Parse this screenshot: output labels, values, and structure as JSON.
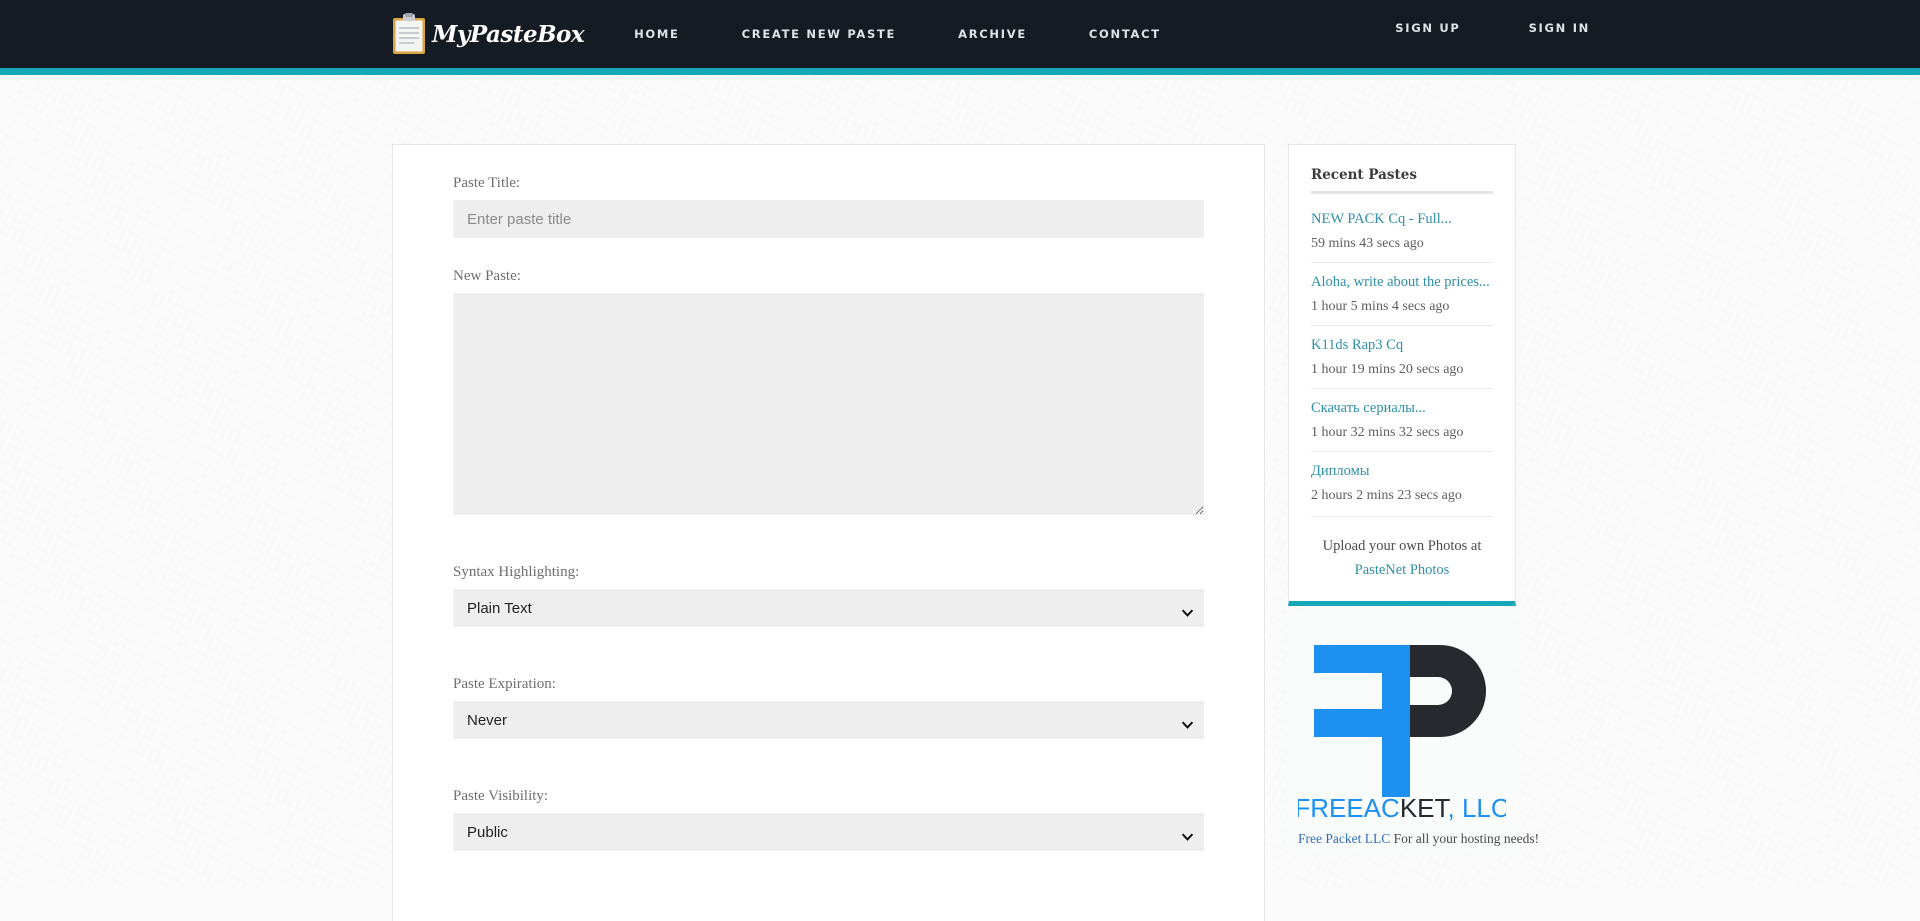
{
  "site": {
    "brand_name": "MyPasteBox",
    "logo_icon": "clipboard-icon",
    "accent_color": "#17a8b8",
    "header_bg": "#141b22"
  },
  "nav": {
    "items": [
      {
        "label": "HOME",
        "name": "nav-home"
      },
      {
        "label": "CREATE NEW PASTE",
        "name": "nav-create-new-paste"
      },
      {
        "label": "ARCHIVE",
        "name": "nav-archive"
      },
      {
        "label": "CONTACT",
        "name": "nav-contact"
      }
    ],
    "auth": [
      {
        "label": "SIGN UP",
        "name": "sign-up-link"
      },
      {
        "label": "SIGN IN",
        "name": "sign-in-link"
      }
    ]
  },
  "form": {
    "title_label": "Paste Title:",
    "title_value": "",
    "title_placeholder": "Enter paste title",
    "paste_label": "New Paste:",
    "paste_value": "",
    "paste_placeholder": "",
    "syntax_label": "Syntax Highlighting:",
    "syntax_value": "Plain Text",
    "syntax_options": [
      "Plain Text"
    ],
    "expiration_label": "Paste Expiration:",
    "expiration_value": "Never",
    "expiration_options": [
      "Never"
    ],
    "visibility_label": "Paste Visibility:",
    "visibility_value": "Public",
    "visibility_options": [
      "Public"
    ],
    "dropdown_icon": "chevron-down-icon"
  },
  "sidebar": {
    "title": "Recent Pastes",
    "pastes": [
      {
        "title": "NEW PACK Cq - Full...",
        "time": "59 mins 43 secs ago"
      },
      {
        "title": "Aloha, write about the prices...",
        "time": "1 hour 5 mins 4 secs ago"
      },
      {
        "title": "K11ds Rap3 Cq",
        "time": "1 hour 19 mins 20 secs ago"
      },
      {
        "title": "Скачать сериалы...",
        "time": "1 hour 32 mins 32 secs ago"
      },
      {
        "title": "Дипломы",
        "time": "2 hours 2 mins 23 secs ago"
      }
    ],
    "promo_text": "Upload your own Photos at",
    "promo_link": "PasteNet Photos"
  },
  "ad": {
    "logo_name": "freeacket-logo",
    "logo_text": "FREEACKET, LLC",
    "logo_blue": "#1e90f2",
    "logo_dark": "#262a2e",
    "caption_link": "Free Packet LLC",
    "caption_rest": " For all your hosting needs!"
  }
}
